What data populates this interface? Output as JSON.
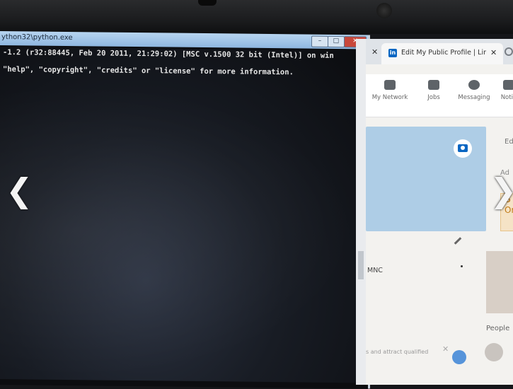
{
  "console": {
    "title": "ython32\\python.exe",
    "line1": "-1.2 (r32:88445, Feb 20 2011, 21:29:02) [MSC v.1500 32 bit (Intel)] on win",
    "line2": "\"help\", \"copyright\", \"credits\" or \"license\" for more information."
  },
  "browser": {
    "tab_title": "Edit My Public Profile | LinkedI",
    "logo_letters": "in",
    "nav": [
      {
        "label": "My Network",
        "icon": "people-icon"
      },
      {
        "label": "Jobs",
        "icon": "briefcase-icon"
      },
      {
        "label": "Messaging",
        "icon": "chat-icon"
      },
      {
        "label": "Notifi",
        "icon": "bell-icon"
      }
    ],
    "side_ed": "Ed",
    "side_ad": "Ad",
    "side_card_t1": "S",
    "side_card_t2": "Or",
    "mnc": "MNC",
    "people": "People",
    "bottom_note": "s and attract qualified"
  },
  "viewer": {
    "prev_arrow": "❮",
    "next_arrow": "❯"
  },
  "colors": {
    "linkedin_blue": "#0a66c2",
    "console_bg": "#0c0d10",
    "titlebar": "#b7d5f0",
    "close_red": "#c8483b"
  }
}
